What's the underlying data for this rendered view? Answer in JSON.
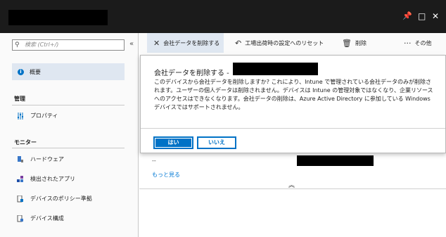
{
  "window": {
    "controls": {
      "pin": "📌",
      "maximize": "□",
      "close": "✕"
    }
  },
  "sidebar": {
    "search_placeholder": "検索 (Ctrl+/)",
    "collapse_glyph": "«",
    "overview": "概要",
    "sections": [
      {
        "title": "管理",
        "items": [
          {
            "label": "プロパティ",
            "icon": "sliders-icon"
          }
        ]
      },
      {
        "title": "モニター",
        "items": [
          {
            "label": "ハードウェア",
            "icon": "hardware-icon"
          },
          {
            "label": "検出されたアプリ",
            "icon": "apps-icon"
          },
          {
            "label": "デバイスのポリシー準拠",
            "icon": "compliance-icon"
          },
          {
            "label": "デバイス構成",
            "icon": "configuration-icon"
          }
        ]
      }
    ]
  },
  "toolbar": {
    "retire": "会社データを削除する",
    "factory_reset": "工場出荷時の設定へのリセット",
    "delete": "削除",
    "more": "その他"
  },
  "content": {
    "dash": "--",
    "more_link": "もっと見る",
    "chevron": "︽"
  },
  "dialog": {
    "title": "会社データを削除する -",
    "body": "このデバイスから会社データを削除しますか? これにより、Intune で管理されている会社データのみが削除されます。ユーザーの個人データは削除されません。デバイスは Intune の管理対象ではなくなり、企業リソースへのアクセスはできなくなります。会社データの削除は、Azure Active Directory に参加している Windows デバイスではサポートされません。",
    "yes": "はい",
    "no": "いいえ"
  },
  "colors": {
    "accent": "#0072c6",
    "titlebar": "#1b1b1b",
    "selected": "#dfe7f1"
  }
}
